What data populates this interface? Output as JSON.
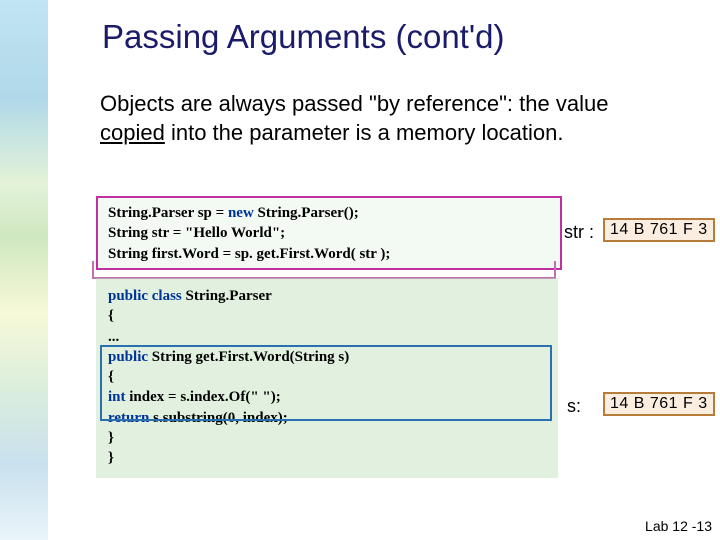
{
  "title_main": "Passing Arguments (cont'd)",
  "body_before": "Objects are always passed \"by reference\": the value ",
  "body_underlined": "copied",
  "body_after": " into the parameter is a memory location.",
  "code_block_1": {
    "l1a": "String.Parser sp = ",
    "l1b": "new",
    "l1c": " String.Parser();",
    "l2": "String str = \"Hello World\";",
    "l3": "String first.Word = sp. get.First.Word( str );"
  },
  "code_block_2": {
    "l1a": "public class",
    "l1b": " String.Parser",
    "l2": "{",
    "l3": "   ...",
    "l4a": "   ",
    "l4b": "public",
    "l4c": " String get.First.Word(String s)",
    "l5": "   {",
    "l6a": "      ",
    "l6b": "int",
    "l6c": " index = s.index.Of(\" \");",
    "l7a": "      ",
    "l7b": "return",
    "l7c": " s.substring(0, index);",
    "l8": "   }",
    "l9": "}"
  },
  "mem_top_label": "str :",
  "mem_top_value": "14 B 761 F 3",
  "mem_bot_label": "s:",
  "mem_bot_value": "14 B 761 F 3",
  "footer": "Lab 12 -13"
}
